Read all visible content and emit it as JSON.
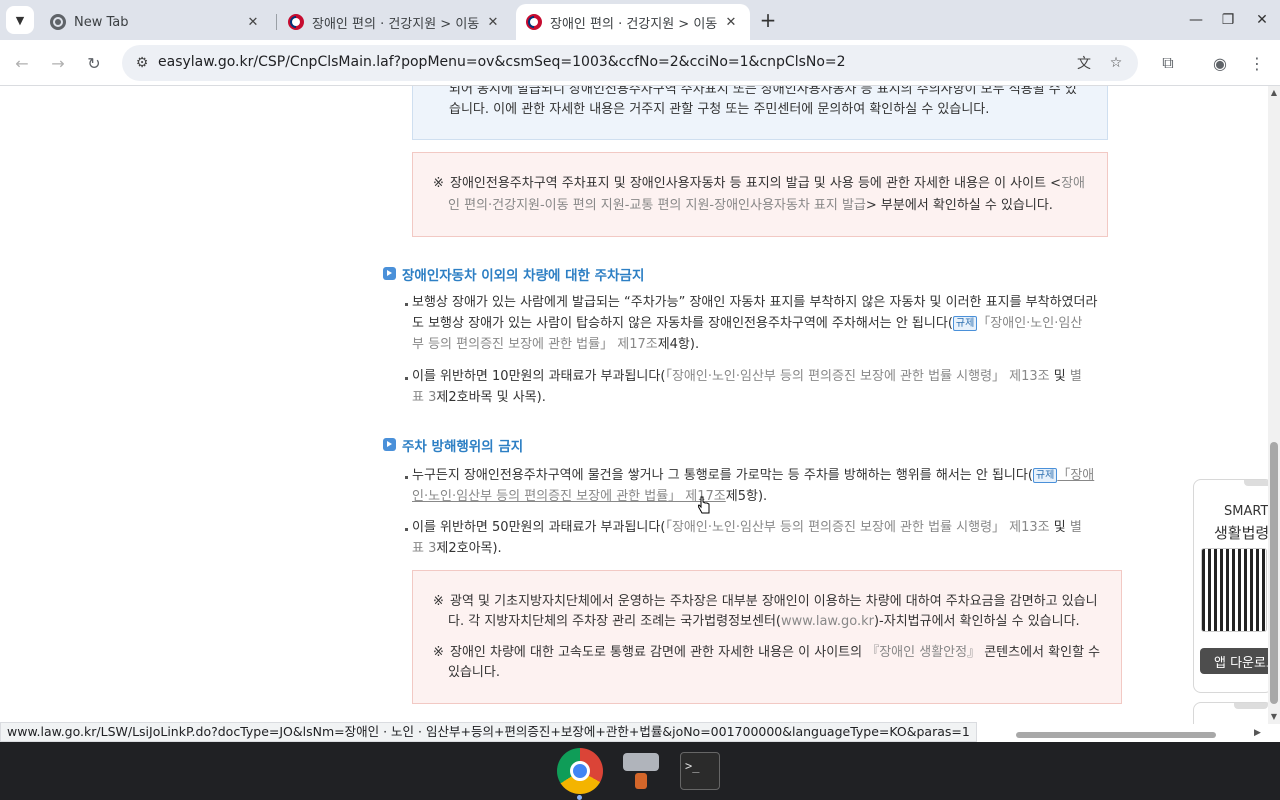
{
  "browser": {
    "tabs": [
      {
        "title": "New Tab",
        "favicon": "chrome-icon",
        "active": false
      },
      {
        "title": "장애인 편의 · 건강지원 > 이동",
        "favicon": "korea-gov-icon",
        "active": false
      },
      {
        "title": "장애인 편의 · 건강지원 > 이동",
        "favicon": "korea-gov-icon",
        "active": true
      }
    ],
    "url": "easylaw.go.kr/CSP/CnpClsMain.laf?popMenu=ov&csmSeq=1003&ccfNo=2&cciNo=1&cnpClsNo=2",
    "status_url": "www.law.go.kr/LSW/LsiJoLinkP.do?docType=JO&lsNm=장애인 · 노인 · 임산부+등의+편의증진+보장에+관한+법률&joNo=001700000&languageType=KO&paras=1"
  },
  "content": {
    "blue_box": {
      "line1": "되어 동시에 발급되니 장애인전용주차구역 주차표지 또는 장애인사용자동차 등 표지의 주의사항이 모두 적용될 수 있",
      "line2": "습니다. 이에 관한 자세한 내용은 거주지 관할 구청 또는 주민센터에 문의하여 확인하실 수 있습니다."
    },
    "pink_box": {
      "mark": "※",
      "line1_a": "장애인전용주차구역 주차표지 및 장애인사용자동차 등 표지의 발급 및 사용 등에 관한 자세한 내용은 이 사이트 <",
      "line1_b": "장애",
      "line2_a": "인 편의·건강지원-이동 편의 지원-교통 편의 지원-장애인사용자동차 표지 발급",
      "line2_b": "> 부분에서 확인하실 수 있습니다."
    },
    "section1": {
      "heading": "장애인자동차 이외의 차량에 대한 주차금지",
      "b1_line1": "보행상 장애가 있는 사람에게 발급되는 “주차가능” 장애인 자동차 표지를 부착하지 않은 자동차 및 이러한 표지를 부착하였더라",
      "b1_line2_a": "도 보행상 장애가 있는 사람이 탑승하지 않은 자동차를 장애인전용주차구역에 주차해서는 안 됩니다(",
      "b1_tag": "규제",
      "b1_line2_b": "「장애인·노인·임산",
      "b1_line3_a": "부 등의 편의증진 보장에 관한 법률」 제17조",
      "b1_line3_b": "제4항).",
      "b2_line1_a": "이를 위반하면 10만원의 과태료가 부과됩니다(",
      "b2_line1_b": "「장애인·노인·임산부 등의 편의증진 보장에 관한 법률 시행령」 제13조",
      "b2_line1_c": " 및 ",
      "b2_line1_d": "별",
      "b2_line2_a": "표 3",
      "b2_line2_b": "제2호바목 및 사목)."
    },
    "section2": {
      "heading": "주차 방해행위의 금지",
      "b1_line1_a": "누구든지 장애인전용주차구역에 물건을 쌓거나 그 통행로를 가로막는 등 주차를 방해하는 행위를 해서는 안 됩니다(",
      "b1_tag": "규제",
      "b1_line1_b": "「장애",
      "b1_line2_a": "인·노인·임산부 등의 편의증진 보장에 관한 법률」 제17조",
      "b1_line2_b": "제5항).",
      "b2_line1_a": "이를 위반하면 50만원의 과태료가 부과됩니다(",
      "b2_line1_b": "「장애인·노인·임산부 등의 편의증진 보장에 관한 법률 시행령」 제13조",
      "b2_line1_c": " 및 ",
      "b2_line1_d": "별",
      "b2_line2_a": "표 3",
      "b2_line2_b": "제2호아목)."
    },
    "pink_box2": {
      "mark": "※",
      "n1_line1": "광역 및 기초지방자치단체에서 운영하는 주차장은 대부분 장애인이 이용하는 차량에 대하여 주차요금을 감면하고 있습니",
      "n1_line2_a": "다. 각 지방자치단체의 주차장 관리 조례는 국가법령정보센터(",
      "n1_line2_b": "www.law.go.kr",
      "n1_line2_c": ")-자치법규에서 확인하실 수 있습니다.",
      "n2_line1_a": "장애인 차량에 대한 고속도로 통행료 감면에 관한 자세한 내용은 이 사이트의 ",
      "n2_line1_b": "『장애인 생활안정』",
      "n2_line1_c": " 콘텐츠에서 확인할 수",
      "n2_line2": "있습니다."
    },
    "smart_widget": {
      "line1": "SMART",
      "line2": "생활법령",
      "app_button": "앱 다운로드"
    }
  },
  "taskbar": {
    "apps": [
      "chrome-icon",
      "game-icon",
      "terminal-icon"
    ],
    "terminal_glyph": ">_"
  }
}
